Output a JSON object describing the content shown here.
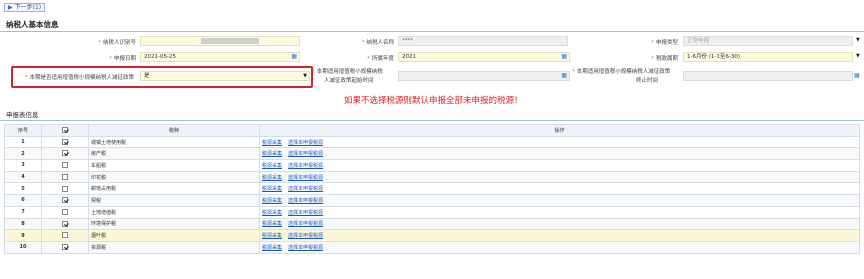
{
  "toolbar": {
    "next_label": "下一步(1)"
  },
  "section_taxpayer": {
    "title": "纳税人基本信息"
  },
  "form": {
    "taxpayer_id": {
      "label": "纳税人识别号",
      "value": ""
    },
    "taxpayer_name": {
      "label": "纳税人名称",
      "value": "****"
    },
    "report_type": {
      "label": "申报类型",
      "value": "正常申报"
    },
    "report_date": {
      "label": "申报日期",
      "value": "2021-05-25"
    },
    "tax_year": {
      "label": "所属年度",
      "value": "2021"
    },
    "tax_period": {
      "label": "税款属期",
      "value": "1-6月份 (1-1至6-30)"
    },
    "small_taxpayer_policy": {
      "label": "本期是否适用增值税小规模纳税人减征政策",
      "value": "是"
    },
    "policy_start": {
      "label_line1": "本期适用增值税小规模纳税",
      "label_line2": "人减征政策起始时间",
      "value": ""
    },
    "policy_end": {
      "label_line1": "本期适用增值税小规模纳税人减征政策",
      "label_line2": "终止时间",
      "value": ""
    }
  },
  "warning_text": "如果不选择税源则默认申报全部未申报的税源！",
  "section_report": {
    "title": "申报表信息"
  },
  "table": {
    "headers": {
      "seq": "序号",
      "tax_type": "税种",
      "ops": "操作"
    },
    "link_collect": "税源采集",
    "link_select": "选择本申报税源",
    "rows": [
      {
        "seq": "1",
        "name": "城镇土地使用税",
        "checked": true
      },
      {
        "seq": "2",
        "name": "房产税",
        "checked": true
      },
      {
        "seq": "3",
        "name": "车船税",
        "checked": false
      },
      {
        "seq": "4",
        "name": "印花税",
        "checked": false
      },
      {
        "seq": "5",
        "name": "耕地占用税",
        "checked": false
      },
      {
        "seq": "6",
        "name": "契税",
        "checked": true
      },
      {
        "seq": "7",
        "name": "土地增值税",
        "checked": false
      },
      {
        "seq": "8",
        "name": "环境保护税",
        "checked": true
      },
      {
        "seq": "9",
        "name": "烟叶税",
        "checked": false
      },
      {
        "seq": "10",
        "name": "资源税",
        "checked": true
      }
    ]
  }
}
